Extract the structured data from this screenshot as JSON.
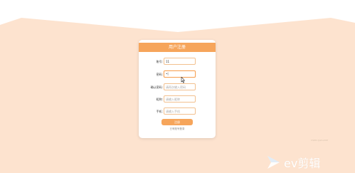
{
  "colors": {
    "background": "#fde3cf",
    "accent": "#f6a55b",
    "field_border": "#f2c08f"
  },
  "card": {
    "title": "用户注册"
  },
  "form": {
    "fields": [
      {
        "label": "账号:",
        "value": "11",
        "placeholder": ""
      },
      {
        "label": "密码:",
        "value": "•|",
        "placeholder": ""
      },
      {
        "label": "确认密码:",
        "value": "",
        "placeholder": "请再次输入密码"
      },
      {
        "label": "昵称:",
        "value": "",
        "placeholder": "请输入昵称"
      },
      {
        "label": "手机:",
        "value": "",
        "placeholder": "请输入手机"
      }
    ],
    "submit_label": "注册",
    "login_link": "已有账号登录"
  },
  "watermark": {
    "text": "ev剪辑",
    "icon": "play-triangle-icon"
  },
  "credit": "CSDN @ahsUOP"
}
